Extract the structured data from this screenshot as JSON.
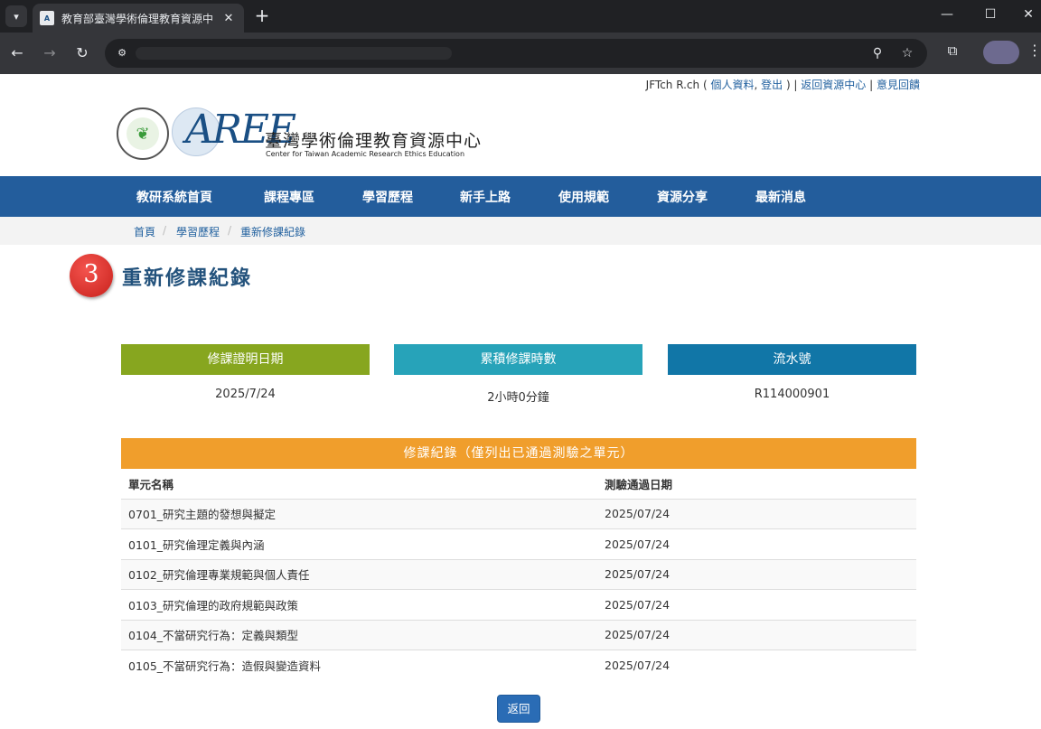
{
  "browser": {
    "tab_title": "教育部臺灣學術倫理教育資源中",
    "favicon_text": "A",
    "tab_close": "✕",
    "new_tab": "+",
    "minimize": "—",
    "maximize": "☐",
    "close": "✕",
    "back": "←",
    "forward": "→",
    "reload": "↻",
    "site_info": "⚙",
    "zoom": "⚲",
    "bookmark": "☆",
    "extensions": "⧉",
    "menu": "⋮"
  },
  "header": {
    "user": "JFTch R.ch",
    "paren_open": " ( ",
    "profile_link": "個人資料",
    "comma": ", ",
    "logout_link": "登出",
    "paren_close": " ) | ",
    "back_center_link": "返回資源中心",
    "sep": " | ",
    "feedback_link": "意見回饋",
    "logo_mark": "AREE",
    "logo_title": "臺灣學術倫理教育資源中心",
    "logo_subtitle": "Center for Taiwan Academic Research Ethics Education"
  },
  "nav": [
    "教研系統首頁",
    "課程專區",
    "學習歷程",
    "新手上路",
    "使用規範",
    "資源分享",
    "最新消息"
  ],
  "breadcrumb": [
    "首頁",
    "學習歷程",
    "重新修課紀錄"
  ],
  "breadcrumb_sep": "/",
  "page": {
    "badge": "3",
    "title": "重新修課紀錄"
  },
  "summary": [
    {
      "label": "修課證明日期",
      "value": "2025/7/24",
      "color": "#87a61f"
    },
    {
      "label": "累積修課時數",
      "value": "2小時0分鐘",
      "color": "#27a3b9"
    },
    {
      "label": "流水號",
      "value": "R114000901",
      "color": "#1176a7"
    }
  ],
  "records": {
    "heading": "修課紀錄（僅列出已通過測驗之單元）",
    "columns": [
      "單元名稱",
      "測驗通過日期"
    ],
    "rows": [
      [
        "0701_研究主題的發想與擬定",
        "2025/07/24"
      ],
      [
        "0101_研究倫理定義與內涵",
        "2025/07/24"
      ],
      [
        "0102_研究倫理專業規範與個人責任",
        "2025/07/24"
      ],
      [
        "0103_研究倫理的政府規範與政策",
        "2025/07/24"
      ],
      [
        "0104_不當研究行為：定義與類型",
        "2025/07/24"
      ],
      [
        "0105_不當研究行為：造假與變造資料",
        "2025/07/24"
      ]
    ]
  },
  "back_button": "返回"
}
